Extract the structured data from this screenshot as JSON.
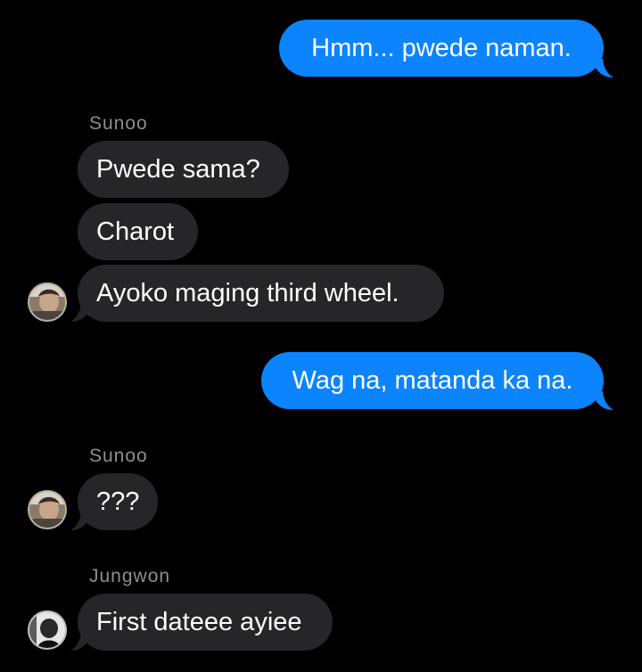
{
  "colors": {
    "background": "#000000",
    "outgoing_bubble": "#0b84fe",
    "incoming_bubble": "#262628",
    "sender_name": "#8e8e93",
    "message_text": "#ffffff"
  },
  "messages": [
    {
      "direction": "outgoing",
      "text": "Hmm... pwede naman."
    },
    {
      "direction": "sender_label",
      "sender": "Sunoo"
    },
    {
      "direction": "incoming",
      "text": "Pwede sama?"
    },
    {
      "direction": "incoming",
      "text": "Charot"
    },
    {
      "direction": "incoming",
      "text": "Ayoko maging third wheel.",
      "avatar": "sunoo-avatar"
    },
    {
      "direction": "outgoing",
      "text": "Wag na, matanda ka na."
    },
    {
      "direction": "sender_label",
      "sender": "Sunoo"
    },
    {
      "direction": "incoming",
      "text": "???",
      "avatar": "sunoo-avatar"
    },
    {
      "direction": "sender_label",
      "sender": "Jungwon"
    },
    {
      "direction": "incoming",
      "text": "First dateee ayiee",
      "avatar": "jungwon-avatar"
    }
  ]
}
